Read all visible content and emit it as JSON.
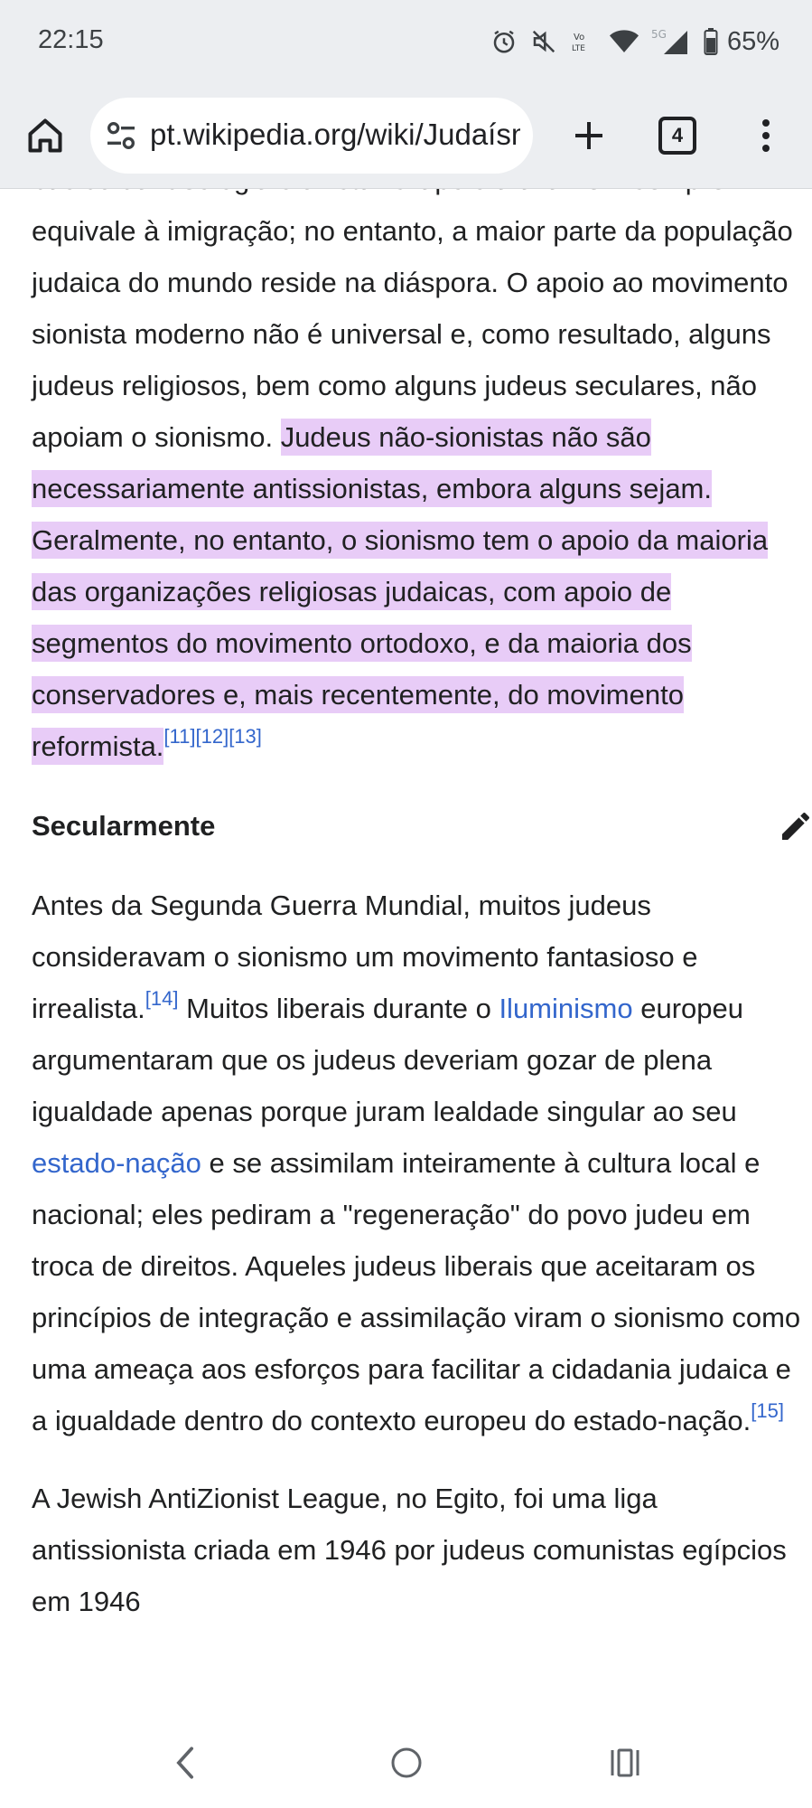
{
  "status_bar": {
    "time": "22:15",
    "battery_percent": "65%",
    "icons": [
      "alarm-icon",
      "mute-icon",
      "volte-icon",
      "wifi-icon",
      "5g-signal-icon",
      "battery-icon"
    ]
  },
  "browser": {
    "url": "pt.wikipedia.org/wiki/Judaísmo",
    "tab_count": "4",
    "icons": [
      "home-icon",
      "site-settings-icon",
      "new-tab-icon",
      "tab-switcher-icon",
      "more-menu-icon"
    ]
  },
  "article": {
    "para1": {
      "plain": "básico da ideologia sionista. O apoio à aliá nem sempre equivale à imigração; no entanto, a maior parte da população judaica do mundo reside na diáspora. O apoio ao movimento sionista moderno não é universal e, como resultado, alguns judeus religiosos, bem como alguns judeus seculares, não apoiam o sionismo. ",
      "highlighted": "Judeus não-sionistas não são necessariamente antissionistas, embora alguns sejam. Geralmente, no entanto, o sionismo tem o apoio da maioria das organizações religiosas judaicas, com apoio de segmentos do movimento ortodoxo, e da maioria dos conservadores e, mais recentemente, do movimento reformista.",
      "refs": [
        "[11]",
        "[12]",
        "[13]"
      ]
    },
    "section_heading": "Secularmente",
    "para2": {
      "t1": "Antes da Segunda Guerra Mundial, muitos judeus consideravam o sionismo um movimento fantasioso e irrealista.",
      "ref1": "[14]",
      "t2": " Muitos liberais durante o ",
      "link1": "Iluminismo",
      "t3": " europeu argumentaram que os judeus deveriam gozar de plena igualdade apenas porque juram lealdade singular ao seu ",
      "link2": "estado-nação",
      "t4": " e se assimilam inteiramente à cultura local e nacional; eles pediram a \"regeneração\" do povo judeu em troca de direitos. Aqueles judeus liberais que aceitaram os princípios de integração e assimilação viram o sionismo como uma ameaça aos esforços para facilitar a cidadania judaica e a igualdade dentro do contexto europeu do estado-nação.",
      "ref2": "[15]"
    },
    "para3": {
      "text": "A Jewish AntiZionist League, no Egito, foi uma liga antissionista criada em 1946 por judeus comunistas egípcios em 1946"
    }
  },
  "nav_bar": {
    "icons": [
      "back-icon",
      "home-circle-icon",
      "recents-icon"
    ]
  },
  "colors": {
    "highlight": "#e8ccf7",
    "link": "#3366cc",
    "chrome_bg": "#eceef1"
  }
}
